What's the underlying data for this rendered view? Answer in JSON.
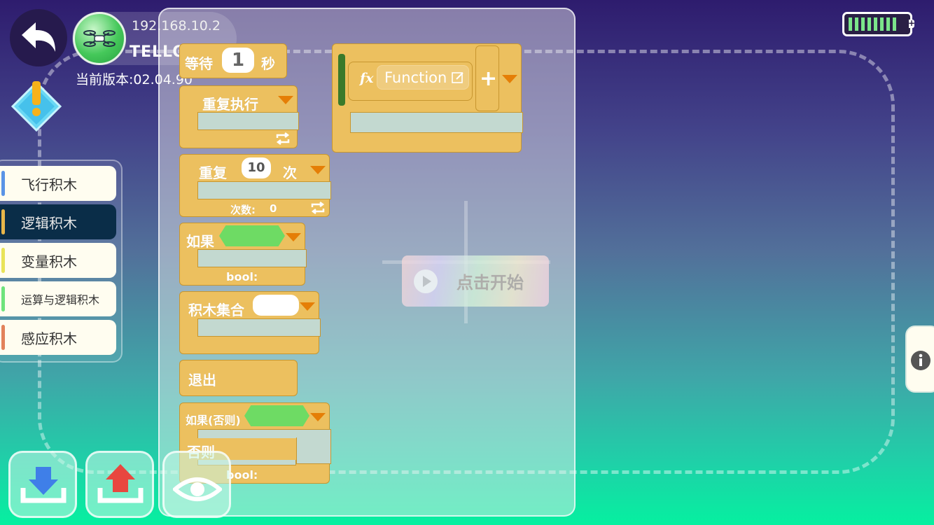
{
  "drone": {
    "ip": "192.168.10.2",
    "name": "TELLO",
    "version": "当前版本:02.04.90"
  },
  "categories": [
    {
      "label": "飞行积木",
      "color": "#5a94e6"
    },
    {
      "label": "逻辑积木",
      "color": "#e7b64a"
    },
    {
      "label": "变量积木",
      "color": "#e8e358"
    },
    {
      "label": "运算与逻辑积木",
      "color": "#6fe37c"
    },
    {
      "label": "感应积木",
      "color": "#e2825a"
    }
  ],
  "blocks": {
    "wait": {
      "label": "等待",
      "value": "1",
      "unit": "秒"
    },
    "repeat_forever": {
      "label": "重复执行"
    },
    "repeat": {
      "label": "重复",
      "value": "10",
      "unit": "次",
      "count_label": "次数:",
      "count_value": "0"
    },
    "if": {
      "label": "如果",
      "bool_label": "bool:"
    },
    "collection": {
      "label": "积木集合"
    },
    "exit": {
      "label": "退出"
    },
    "if_else": {
      "label": "如果(否则)",
      "else_label": "否则",
      "bool_label": "bool:"
    },
    "function": {
      "label": "Function",
      "fx": "fx",
      "add": "+"
    }
  },
  "start": {
    "label": "点击开始"
  },
  "battery": {
    "level": 0.8,
    "plus": "+"
  }
}
